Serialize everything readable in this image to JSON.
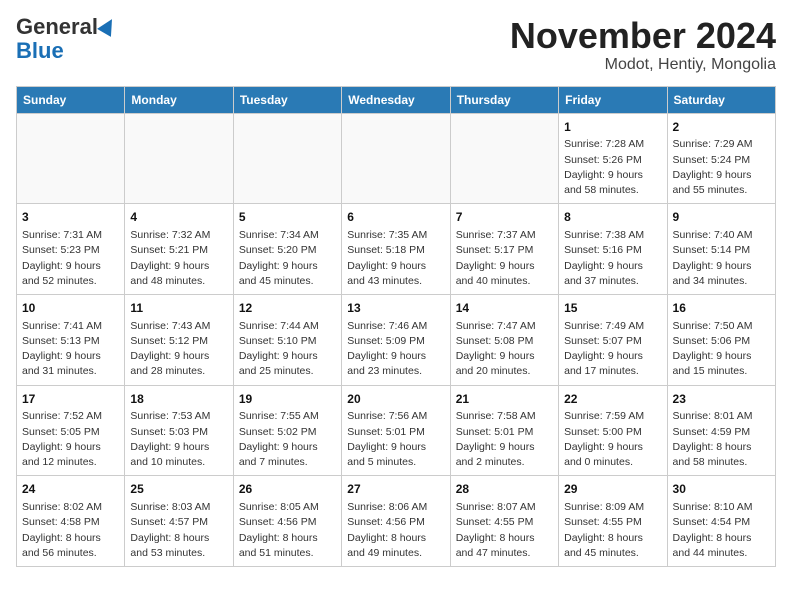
{
  "header": {
    "logo_general": "General",
    "logo_blue": "Blue",
    "month_year": "November 2024",
    "location": "Modot, Hentiy, Mongolia"
  },
  "days_of_week": [
    "Sunday",
    "Monday",
    "Tuesday",
    "Wednesday",
    "Thursday",
    "Friday",
    "Saturday"
  ],
  "weeks": [
    [
      {
        "day": "",
        "info": ""
      },
      {
        "day": "",
        "info": ""
      },
      {
        "day": "",
        "info": ""
      },
      {
        "day": "",
        "info": ""
      },
      {
        "day": "",
        "info": ""
      },
      {
        "day": "1",
        "info": "Sunrise: 7:28 AM\nSunset: 5:26 PM\nDaylight: 9 hours\nand 58 minutes."
      },
      {
        "day": "2",
        "info": "Sunrise: 7:29 AM\nSunset: 5:24 PM\nDaylight: 9 hours\nand 55 minutes."
      }
    ],
    [
      {
        "day": "3",
        "info": "Sunrise: 7:31 AM\nSunset: 5:23 PM\nDaylight: 9 hours\nand 52 minutes."
      },
      {
        "day": "4",
        "info": "Sunrise: 7:32 AM\nSunset: 5:21 PM\nDaylight: 9 hours\nand 48 minutes."
      },
      {
        "day": "5",
        "info": "Sunrise: 7:34 AM\nSunset: 5:20 PM\nDaylight: 9 hours\nand 45 minutes."
      },
      {
        "day": "6",
        "info": "Sunrise: 7:35 AM\nSunset: 5:18 PM\nDaylight: 9 hours\nand 43 minutes."
      },
      {
        "day": "7",
        "info": "Sunrise: 7:37 AM\nSunset: 5:17 PM\nDaylight: 9 hours\nand 40 minutes."
      },
      {
        "day": "8",
        "info": "Sunrise: 7:38 AM\nSunset: 5:16 PM\nDaylight: 9 hours\nand 37 minutes."
      },
      {
        "day": "9",
        "info": "Sunrise: 7:40 AM\nSunset: 5:14 PM\nDaylight: 9 hours\nand 34 minutes."
      }
    ],
    [
      {
        "day": "10",
        "info": "Sunrise: 7:41 AM\nSunset: 5:13 PM\nDaylight: 9 hours\nand 31 minutes."
      },
      {
        "day": "11",
        "info": "Sunrise: 7:43 AM\nSunset: 5:12 PM\nDaylight: 9 hours\nand 28 minutes."
      },
      {
        "day": "12",
        "info": "Sunrise: 7:44 AM\nSunset: 5:10 PM\nDaylight: 9 hours\nand 25 minutes."
      },
      {
        "day": "13",
        "info": "Sunrise: 7:46 AM\nSunset: 5:09 PM\nDaylight: 9 hours\nand 23 minutes."
      },
      {
        "day": "14",
        "info": "Sunrise: 7:47 AM\nSunset: 5:08 PM\nDaylight: 9 hours\nand 20 minutes."
      },
      {
        "day": "15",
        "info": "Sunrise: 7:49 AM\nSunset: 5:07 PM\nDaylight: 9 hours\nand 17 minutes."
      },
      {
        "day": "16",
        "info": "Sunrise: 7:50 AM\nSunset: 5:06 PM\nDaylight: 9 hours\nand 15 minutes."
      }
    ],
    [
      {
        "day": "17",
        "info": "Sunrise: 7:52 AM\nSunset: 5:05 PM\nDaylight: 9 hours\nand 12 minutes."
      },
      {
        "day": "18",
        "info": "Sunrise: 7:53 AM\nSunset: 5:03 PM\nDaylight: 9 hours\nand 10 minutes."
      },
      {
        "day": "19",
        "info": "Sunrise: 7:55 AM\nSunset: 5:02 PM\nDaylight: 9 hours\nand 7 minutes."
      },
      {
        "day": "20",
        "info": "Sunrise: 7:56 AM\nSunset: 5:01 PM\nDaylight: 9 hours\nand 5 minutes."
      },
      {
        "day": "21",
        "info": "Sunrise: 7:58 AM\nSunset: 5:01 PM\nDaylight: 9 hours\nand 2 minutes."
      },
      {
        "day": "22",
        "info": "Sunrise: 7:59 AM\nSunset: 5:00 PM\nDaylight: 9 hours\nand 0 minutes."
      },
      {
        "day": "23",
        "info": "Sunrise: 8:01 AM\nSunset: 4:59 PM\nDaylight: 8 hours\nand 58 minutes."
      }
    ],
    [
      {
        "day": "24",
        "info": "Sunrise: 8:02 AM\nSunset: 4:58 PM\nDaylight: 8 hours\nand 56 minutes."
      },
      {
        "day": "25",
        "info": "Sunrise: 8:03 AM\nSunset: 4:57 PM\nDaylight: 8 hours\nand 53 minutes."
      },
      {
        "day": "26",
        "info": "Sunrise: 8:05 AM\nSunset: 4:56 PM\nDaylight: 8 hours\nand 51 minutes."
      },
      {
        "day": "27",
        "info": "Sunrise: 8:06 AM\nSunset: 4:56 PM\nDaylight: 8 hours\nand 49 minutes."
      },
      {
        "day": "28",
        "info": "Sunrise: 8:07 AM\nSunset: 4:55 PM\nDaylight: 8 hours\nand 47 minutes."
      },
      {
        "day": "29",
        "info": "Sunrise: 8:09 AM\nSunset: 4:55 PM\nDaylight: 8 hours\nand 45 minutes."
      },
      {
        "day": "30",
        "info": "Sunrise: 8:10 AM\nSunset: 4:54 PM\nDaylight: 8 hours\nand 44 minutes."
      }
    ]
  ]
}
